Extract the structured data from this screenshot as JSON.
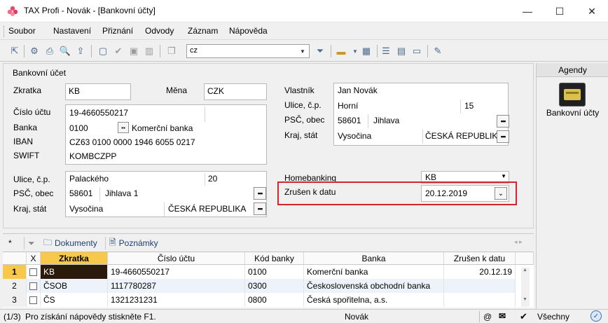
{
  "window": {
    "title": "TAX Profi - Novák - [Bankovní účty]",
    "controls": {
      "minimize": "—",
      "maximize": "☐",
      "close": "✕"
    }
  },
  "menu": {
    "items": [
      "Soubor",
      "Nastavení",
      "Přiznání",
      "Odvody",
      "Záznam",
      "Nápověda"
    ]
  },
  "toolbar": {
    "combo_value": "cz"
  },
  "form": {
    "section_title": "Bankovní účet",
    "zkratka_label": "Zkratka",
    "zkratka_value": "KB",
    "mena_label": "Měna",
    "mena_value": "CZK",
    "cislo_label": "Číslo účtu",
    "cislo_value": "19-4660550217",
    "banka_label": "Banka",
    "banka_code": "0100",
    "banka_name": "Komerční banka",
    "iban_label": "IBAN",
    "iban_value": "CZ63 0100 0000 1946 6055 0217",
    "swift_label": "SWIFT",
    "swift_value": "KOMBCZPP",
    "ulice_label": "Ulice, č.p.",
    "ulice_value": "Palackého",
    "ulice_cp": "20",
    "psc_label": "PSČ, obec",
    "psc_value": "58601",
    "obec_value": "Jihlava 1",
    "kraj_label": "Kraj, stát",
    "kraj_value": "Vysočina",
    "stat_value": "ČESKÁ REPUBLIKA",
    "vlastnik_label": "Vlastník",
    "vlastnik_value": "Jan Novák",
    "v_ulice_label": "Ulice, č.p.",
    "v_ulice_value": "Horní",
    "v_ulice_cp": "15",
    "v_psc_label": "PSČ, obec",
    "v_psc_value": "58601",
    "v_obec_value": "Jihlava",
    "v_kraj_label": "Kraj, stát",
    "v_kraj_value": "Vysočina",
    "v_stat_value": "ČESKÁ REPUBLIKA",
    "homebanking_label": "Homebanking",
    "homebanking_value": "KB",
    "zrusen_label": "Zrušen k datu",
    "zrusen_value": "20.12.2019"
  },
  "agendy": {
    "header": "Agendy",
    "item_label": "Bankovní účty"
  },
  "tabs": {
    "star": "*",
    "dokumenty": "Dokumenty",
    "poznamky": "Poznámky"
  },
  "grid": {
    "columns": [
      "X",
      "Zkratka",
      "Číslo účtu",
      "Kód banky",
      "Banka",
      "Zrušen k datu"
    ],
    "rows": [
      {
        "num": "1",
        "zkratka": "KB",
        "cislo": "19-4660550217",
        "kod": "0100",
        "banka": "Komerční banka",
        "zrusen": "20.12.19"
      },
      {
        "num": "2",
        "zkratka": "ČSOB",
        "cislo": "1117780287",
        "kod": "0300",
        "banka": "Československá obchodní banka",
        "zrusen": ""
      },
      {
        "num": "3",
        "zkratka": "ČS",
        "cislo": "1321231231",
        "kod": "0800",
        "banka": "Česká spořitelna, a.s.",
        "zrusen": ""
      }
    ]
  },
  "status": {
    "position": "(1/3)",
    "help": "Pro získání nápovědy stiskněte F1.",
    "user": "Novák",
    "at": "@",
    "filter": "Všechny"
  },
  "colors": {
    "highlight_red": "#d6232c",
    "selected_cell": "#2b1a0b",
    "row_number_active": "#f7c84a"
  }
}
